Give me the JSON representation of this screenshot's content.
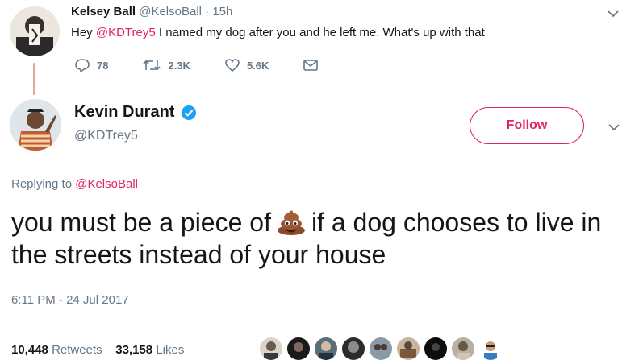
{
  "parent_tweet": {
    "name": "Kelsey Ball",
    "handle": "@KelsoBall",
    "dot": "·",
    "time": "15h",
    "text_prefix": "Hey ",
    "mention": "@KDTrey5",
    "text_suffix": " I named my dog after you and he left me. What's up with that",
    "replies": "78",
    "retweets": "2.3K",
    "likes": "5.6K"
  },
  "main_tweet": {
    "name": "Kevin Durant",
    "handle": "@KDTrey5",
    "follow_label": "Follow",
    "replying_prefix": "Replying to ",
    "replying_handle": "@KelsoBall",
    "text_before_emoji": "you must be a piece of",
    "emoji_icon": "pile-of-poo-icon",
    "text_after_emoji": "if a dog chooses to live in the streets instead of your house",
    "timestamp": "6:11 PM - 24 Jul 2017",
    "retweet_count": "10,448",
    "retweet_label": "Retweets",
    "like_count": "33,158",
    "like_label": "Likes"
  },
  "colors": {
    "accent": "#e0245e",
    "muted": "#657786",
    "verified": "#1da1f2"
  }
}
